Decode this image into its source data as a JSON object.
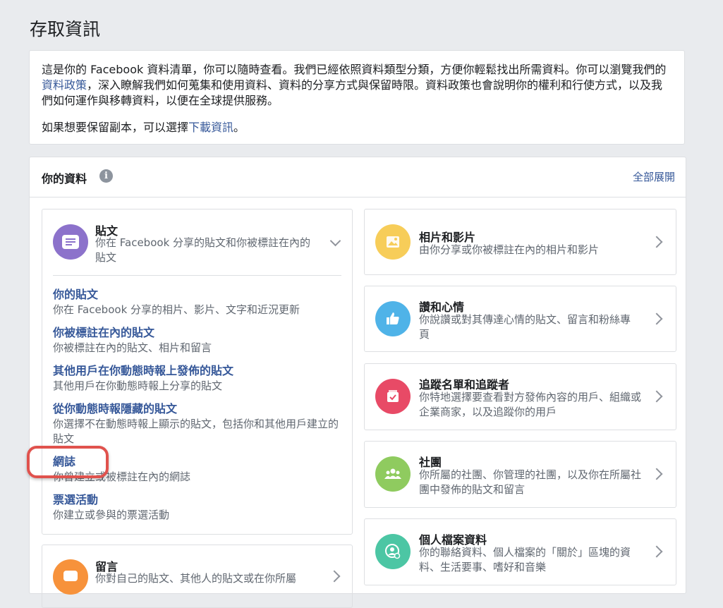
{
  "page_title": "存取資訊",
  "intro": {
    "p1_before": "這是你的 Facebook 資料清單，你可以隨時查看。我們已經依照資料類型分類，方便你輕鬆找出所需資料。你可以瀏覽我們的",
    "p1_link": "資料政策",
    "p1_after": "，深入瞭解我們如何蒐集和使用資料、資料的分享方式與保留時限。資料政策也會說明你的權利和行使方式，以及我們如何運作與移轉資料，以便在全球提供服務。",
    "p2_before": "如果想要保留副本，可以選擇",
    "p2_link": "下載資訊",
    "p2_after": "。"
  },
  "your_data": {
    "title": "你的資料",
    "info_icon_glyph": "i",
    "expand_all": "全部展開"
  },
  "posts_category": {
    "title": "貼文",
    "description": "你在 Facebook 分享的貼文和你被標註在內的貼文",
    "icon": "posts-icon",
    "color": "#8c72cb",
    "items": [
      {
        "title": "你的貼文",
        "description": "你在 Facebook 分享的相片、影片、文字和近況更新"
      },
      {
        "title": "你被標註在內的貼文",
        "description": "你被標註在內的貼文、相片和留言"
      },
      {
        "title": "其他用戶在你動態時報上發佈的貼文",
        "description": "其他用戶在你動態時報上分享的貼文"
      },
      {
        "title": "從你動態時報隱藏的貼文",
        "description": "你選擇不在動態時報上顯示的貼文，包括你和其他用戶建立的貼文"
      },
      {
        "title": "網誌",
        "description": "你曾建立或被標註在內的網誌"
      },
      {
        "title": "票選活動",
        "description": "你建立或參與的票選活動"
      }
    ]
  },
  "comments_category": {
    "title": "留言",
    "description": "你對自己的貼文、其他人的貼文或在你所屬",
    "icon": "comments-icon",
    "color": "#f7923b"
  },
  "right_categories": [
    {
      "title": "相片和影片",
      "description": "由你分享或你被標註在內的相片和影片",
      "icon": "photos-icon",
      "color": "#f7cd59"
    },
    {
      "title": "讚和心情",
      "description": "你說讚或對其傳達心情的貼文、留言和粉絲專頁",
      "icon": "like-icon",
      "color": "#4fb3e8"
    },
    {
      "title": "追蹤名單和追蹤者",
      "description": "你特地選擇要查看對方發佈內容的用戶、組織或企業商家，以及追蹤你的用戶",
      "icon": "following-icon",
      "color": "#e84a66"
    },
    {
      "title": "社團",
      "description": "你所屬的社團、你管理的社團，以及你在所屬社團中發佈的貼文和留言",
      "icon": "groups-icon",
      "color": "#8fcb5f"
    },
    {
      "title": "個人檔案資料",
      "description": "你的聯絡資料、個人檔案的「關於」區塊的資料、生活要事、嗜好和音樂",
      "icon": "profile-icon",
      "color": "#4cc6a4"
    }
  ]
}
